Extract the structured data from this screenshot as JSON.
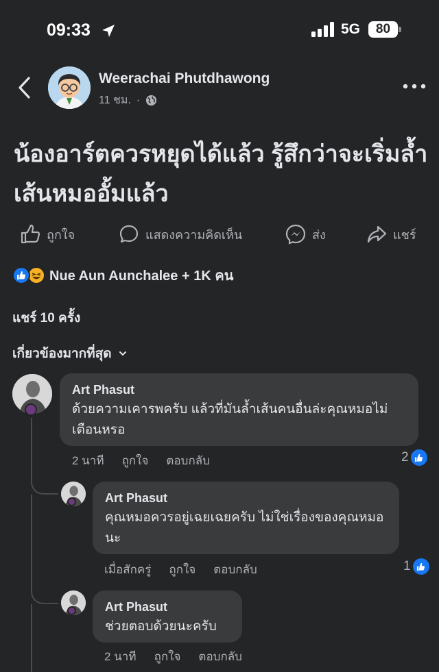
{
  "status_bar": {
    "time": "09:33",
    "network": "5G",
    "battery": "80"
  },
  "post": {
    "author": "Weerachai Phutdhawong",
    "time": "11 ชม.",
    "separator": "·",
    "text": "น้องอาร์ตควรหยุดได้แล้ว รู้สึกว่าจะเริ่มล้ำเส้นหมออั้มแล้ว"
  },
  "actions": {
    "like": "ถูกใจ",
    "comment": "แสดงความคิดเห็น",
    "send": "ส่ง",
    "share": "แชร์"
  },
  "reactions": {
    "text": "Nue Aun Aunchalee + 1K คน"
  },
  "shares": {
    "text": "แชร์ 10 ครั้ง"
  },
  "sort": {
    "label": "เกี่ยวข้องมากที่สุด"
  },
  "comments": [
    {
      "name": "Art Phasut",
      "text": "ด้วยความเคารพครับ แล้วที่มันล้ำเส้นคนอื่นล่ะคุณหมอไม่เตือนหรอ",
      "time": "2 นาที",
      "like": "ถูกใจ",
      "reply": "ตอบกลับ",
      "likes": "2"
    },
    {
      "name": "Art Phasut",
      "text": "คุณหมอควรอยู่เฉยเฉยครับ ไม่ใช่เรื่องของคุณหมอนะ",
      "time": "เมื่อสักครู่",
      "like": "ถูกใจ",
      "reply": "ตอบกลับ",
      "likes": "1"
    },
    {
      "name": "Art Phasut",
      "text": "ช่วยตอบด้วยนะครับ",
      "time": "2 นาที",
      "like": "ถูกใจ",
      "reply": "ตอบกลับ"
    }
  ],
  "colors": {
    "background": "#242526",
    "bubble": "#3a3b3c",
    "accent": "#1877f2",
    "secondary_text": "#b0b3b8"
  }
}
